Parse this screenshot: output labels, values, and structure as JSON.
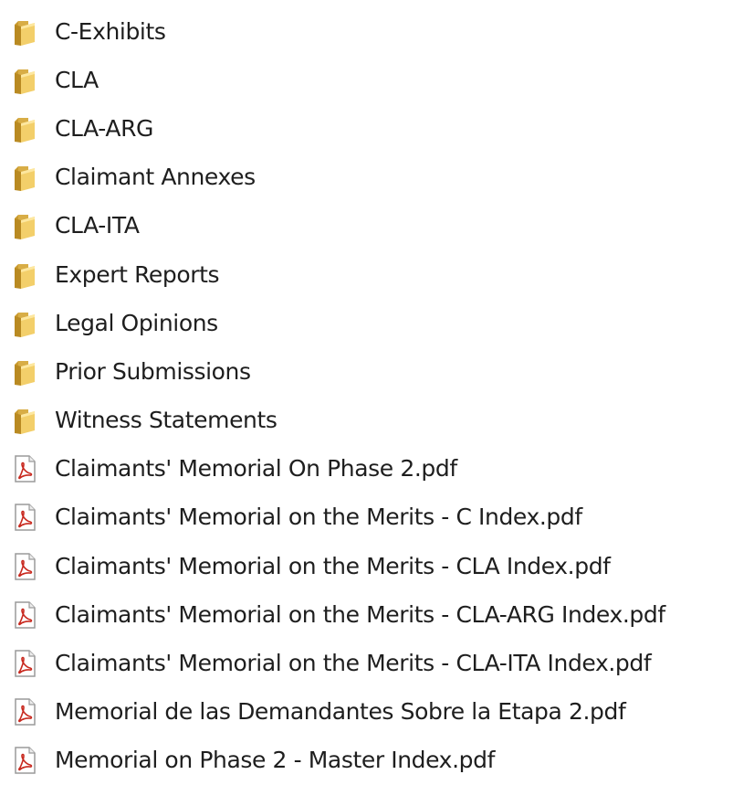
{
  "explorer": {
    "items": [
      {
        "name": "C-Exhibits",
        "type": "folder",
        "icon": "folder-icon"
      },
      {
        "name": "CLA",
        "type": "folder",
        "icon": "folder-icon"
      },
      {
        "name": "CLA-ARG",
        "type": "folder",
        "icon": "folder-icon"
      },
      {
        "name": "Claimant Annexes",
        "type": "folder",
        "icon": "folder-icon"
      },
      {
        "name": "CLA-ITA",
        "type": "folder",
        "icon": "folder-icon"
      },
      {
        "name": "Expert Reports",
        "type": "folder",
        "icon": "folder-icon"
      },
      {
        "name": "Legal Opinions",
        "type": "folder",
        "icon": "folder-icon"
      },
      {
        "name": "Prior Submissions",
        "type": "folder",
        "icon": "folder-icon"
      },
      {
        "name": "Witness Statements",
        "type": "folder",
        "icon": "folder-icon"
      },
      {
        "name": "Claimants' Memorial On Phase 2.pdf",
        "type": "pdf",
        "icon": "pdf-file-icon"
      },
      {
        "name": "Claimants' Memorial on the Merits - C Index.pdf",
        "type": "pdf",
        "icon": "pdf-file-icon"
      },
      {
        "name": "Claimants' Memorial on the Merits - CLA Index.pdf",
        "type": "pdf",
        "icon": "pdf-file-icon"
      },
      {
        "name": "Claimants' Memorial on the Merits - CLA-ARG Index.pdf",
        "type": "pdf",
        "icon": "pdf-file-icon"
      },
      {
        "name": "Claimants' Memorial on the Merits - CLA-ITA Index.pdf",
        "type": "pdf",
        "icon": "pdf-file-icon"
      },
      {
        "name": "Memorial de las Demandantes Sobre la Etapa 2.pdf",
        "type": "pdf",
        "icon": "pdf-file-icon"
      },
      {
        "name": "Memorial on Phase 2 - Master Index.pdf",
        "type": "pdf",
        "icon": "pdf-file-icon"
      }
    ]
  },
  "colors": {
    "folder_back": "#c99a2e",
    "folder_front": "#f3cf6a",
    "pdf_red": "#c8281e",
    "text": "#1e1e1e"
  }
}
